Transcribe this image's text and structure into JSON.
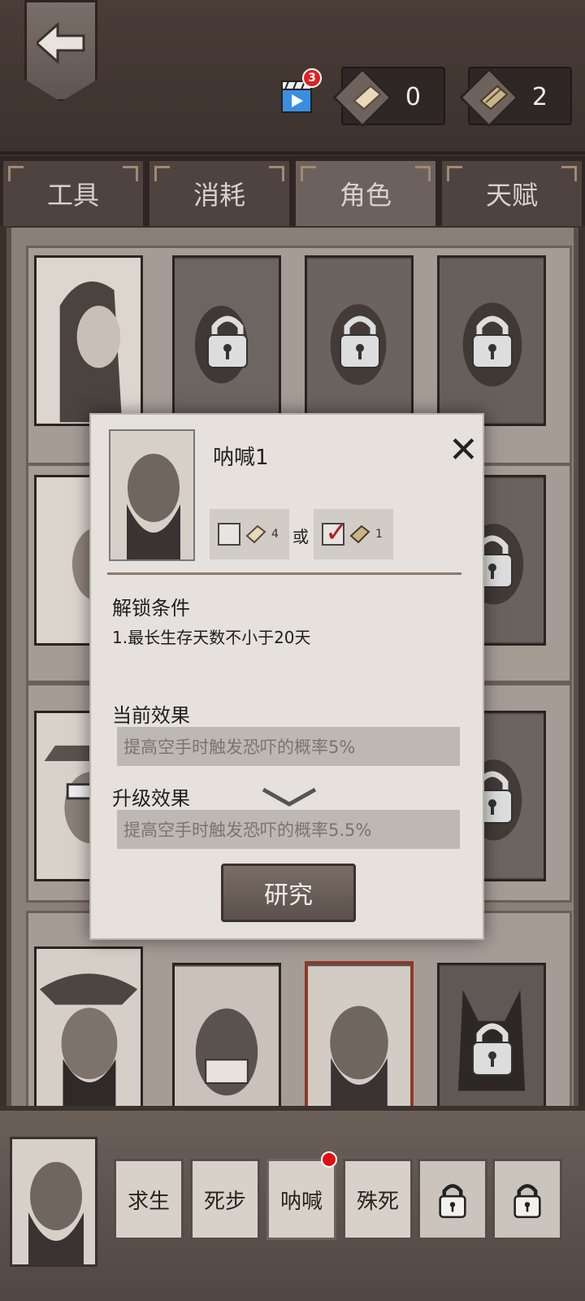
{
  "topbar": {
    "video_badge": "3",
    "currency_1": "0",
    "currency_2": "2"
  },
  "tabs": [
    {
      "label": "工具"
    },
    {
      "label": "消耗"
    },
    {
      "label": "角色"
    },
    {
      "label": "天赋"
    }
  ],
  "popup": {
    "title": "呐喊1",
    "cost_option_1": "4",
    "cost_or": "或",
    "cost_option_2": "1",
    "unlock_title": "解锁条件",
    "unlock_condition": "1.最长生存天数不小于20天",
    "current_title": "当前效果",
    "current_effect": "提高空手时触发恐吓的概率5%",
    "upgrade_title": "升级效果",
    "upgrade_effect": "提高空手时触发恐吓的概率5.5%",
    "research_label": "研究"
  },
  "skills": [
    {
      "label": "求生"
    },
    {
      "label": "死步"
    },
    {
      "label": "呐喊"
    },
    {
      "label": "殊死"
    }
  ]
}
